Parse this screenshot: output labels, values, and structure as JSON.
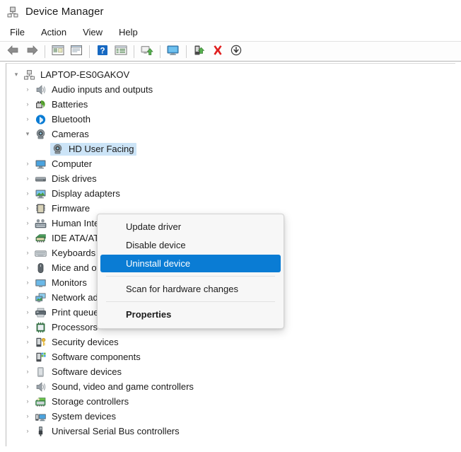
{
  "window": {
    "title": "Device Manager",
    "title_icon": "device-manager-icon"
  },
  "menubar": {
    "items": [
      {
        "label": "File",
        "name": "menu-file"
      },
      {
        "label": "Action",
        "name": "menu-action"
      },
      {
        "label": "View",
        "name": "menu-view"
      },
      {
        "label": "Help",
        "name": "menu-help"
      }
    ]
  },
  "toolbar": {
    "buttons": [
      {
        "icon": "back-arrow-icon",
        "name": "toolbar-back"
      },
      {
        "icon": "forward-arrow-icon",
        "name": "toolbar-forward"
      },
      {
        "sep": true
      },
      {
        "icon": "show-hide-console-tree-icon",
        "name": "toolbar-console-tree"
      },
      {
        "icon": "properties-icon",
        "name": "toolbar-properties"
      },
      {
        "sep": true
      },
      {
        "icon": "help-icon",
        "name": "toolbar-help"
      },
      {
        "icon": "details-view-icon",
        "name": "toolbar-details-view"
      },
      {
        "sep": true
      },
      {
        "icon": "update-driver-icon",
        "name": "toolbar-update-driver"
      },
      {
        "sep": true
      },
      {
        "icon": "scan-hardware-changes-icon",
        "name": "toolbar-scan-hardware"
      },
      {
        "sep": true
      },
      {
        "icon": "enable-device-icon",
        "name": "toolbar-enable-device"
      },
      {
        "icon": "uninstall-device-icon",
        "name": "toolbar-uninstall-device"
      },
      {
        "icon": "disable-device-icon",
        "name": "toolbar-disable-device"
      }
    ]
  },
  "tree": {
    "nodes": [
      {
        "label": "LAPTOP-ES0GAKOV",
        "level": 0,
        "state": "expanded",
        "icon": "computer-node-icon",
        "name": "tree-node-laptop-es0gakov"
      },
      {
        "label": "Audio inputs and outputs",
        "level": 1,
        "state": "collapsed",
        "icon": "speaker-icon",
        "name": "tree-node-audio-inputs-and-outputs"
      },
      {
        "label": "Batteries",
        "level": 1,
        "state": "collapsed",
        "icon": "battery-icon",
        "name": "tree-node-batteries"
      },
      {
        "label": "Bluetooth",
        "level": 1,
        "state": "collapsed",
        "icon": "bluetooth-icon",
        "name": "tree-node-bluetooth"
      },
      {
        "label": "Cameras",
        "level": 1,
        "state": "expanded",
        "icon": "camera-icon",
        "name": "tree-node-cameras"
      },
      {
        "label": "HD User Facing",
        "level": 2,
        "state": "leaf",
        "icon": "camera-device-icon",
        "selected": true,
        "name": "tree-node-hd-user-facing"
      },
      {
        "label": "Computer",
        "level": 1,
        "state": "collapsed",
        "icon": "computer-icon",
        "name": "tree-node-computer"
      },
      {
        "label": "Disk drives",
        "level": 1,
        "state": "collapsed",
        "icon": "disk-drive-icon",
        "name": "tree-node-disk-drives"
      },
      {
        "label": "Display adapters",
        "level": 1,
        "state": "collapsed",
        "icon": "display-adapter-icon",
        "name": "tree-node-display-adapters"
      },
      {
        "label": "Firmware",
        "level": 1,
        "state": "collapsed",
        "icon": "firmware-icon",
        "name": "tree-node-firmware"
      },
      {
        "label": "Human Interface Devices",
        "level": 1,
        "state": "collapsed",
        "icon": "hid-icon",
        "name": "tree-node-human-interface-devices"
      },
      {
        "label": "IDE ATA/ATAPI controllers",
        "level": 1,
        "state": "collapsed",
        "icon": "ide-controller-icon",
        "name": "tree-node-ide-ata-atapi-controllers"
      },
      {
        "label": "Keyboards",
        "level": 1,
        "state": "collapsed",
        "icon": "keyboard-icon",
        "name": "tree-node-keyboards"
      },
      {
        "label": "Mice and other pointing devices",
        "level": 1,
        "state": "collapsed",
        "icon": "mouse-icon",
        "name": "tree-node-mice-and-other-pointing-devices"
      },
      {
        "label": "Monitors",
        "level": 1,
        "state": "collapsed",
        "icon": "monitor-icon",
        "name": "tree-node-monitors"
      },
      {
        "label": "Network adapters",
        "level": 1,
        "state": "collapsed",
        "icon": "network-adapter-icon",
        "name": "tree-node-network-adapters"
      },
      {
        "label": "Print queues",
        "level": 1,
        "state": "collapsed",
        "icon": "printer-icon",
        "name": "tree-node-print-queues"
      },
      {
        "label": "Processors",
        "level": 1,
        "state": "collapsed",
        "icon": "processor-icon",
        "name": "tree-node-processors"
      },
      {
        "label": "Security devices",
        "level": 1,
        "state": "collapsed",
        "icon": "security-device-icon",
        "name": "tree-node-security-devices"
      },
      {
        "label": "Software components",
        "level": 1,
        "state": "collapsed",
        "icon": "software-component-icon",
        "name": "tree-node-software-components"
      },
      {
        "label": "Software devices",
        "level": 1,
        "state": "collapsed",
        "icon": "software-device-icon",
        "name": "tree-node-software-devices"
      },
      {
        "label": "Sound, video and game controllers",
        "level": 1,
        "state": "collapsed",
        "icon": "sound-controller-icon",
        "name": "tree-node-sound-video-and-game-controllers"
      },
      {
        "label": "Storage controllers",
        "level": 1,
        "state": "collapsed",
        "icon": "storage-controller-icon",
        "name": "tree-node-storage-controllers"
      },
      {
        "label": "System devices",
        "level": 1,
        "state": "collapsed",
        "icon": "system-device-icon",
        "name": "tree-node-system-devices"
      },
      {
        "label": "Universal Serial Bus controllers",
        "level": 1,
        "state": "collapsed",
        "icon": "usb-icon",
        "name": "tree-node-universal-serial-bus-controllers"
      }
    ]
  },
  "context_menu": {
    "items": [
      {
        "label": "Update driver",
        "name": "ctx-update-driver",
        "highlight": false,
        "bold": false
      },
      {
        "label": "Disable device",
        "name": "ctx-disable-device",
        "highlight": false,
        "bold": false
      },
      {
        "label": "Uninstall device",
        "name": "ctx-uninstall-device",
        "highlight": true,
        "bold": false
      },
      {
        "sep": true
      },
      {
        "label": "Scan for hardware changes",
        "name": "ctx-scan-for-hardware-changes",
        "highlight": false,
        "bold": false
      },
      {
        "sep": true
      },
      {
        "label": "Properties",
        "name": "ctx-properties",
        "highlight": false,
        "bold": true
      }
    ]
  },
  "colors": {
    "highlight_blue": "#0a7cd4",
    "selection_blue": "#cce4f7",
    "text": "#1b1b1b",
    "window_bg": "#ffffff",
    "menu_bg": "#f7f7f7"
  }
}
